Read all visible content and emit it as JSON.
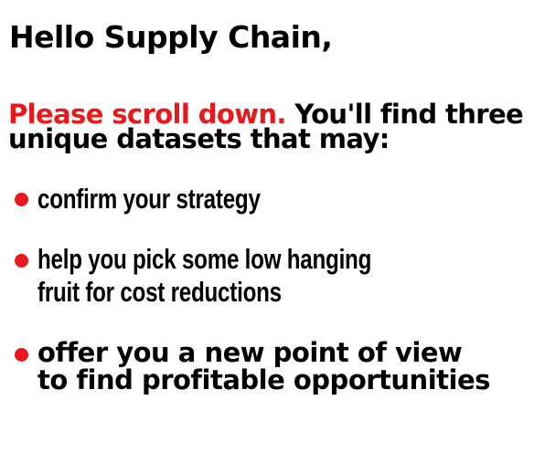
{
  "greeting": "Hello Supply Chain,",
  "intro": {
    "highlight": "Please scroll down.",
    "rest": " You'll find three unique datasets that may:"
  },
  "bullets": [
    {
      "lines": [
        "confirm your strategy"
      ]
    },
    {
      "lines": [
        "help you pick some low hanging",
        "fruit for cost reductions"
      ]
    },
    {
      "lines": [
        "offer you a new point of view",
        "to find profitable opportunities"
      ]
    }
  ],
  "colors": {
    "accent": "#e8181b",
    "text": "#000000",
    "background": "#ffffff"
  }
}
